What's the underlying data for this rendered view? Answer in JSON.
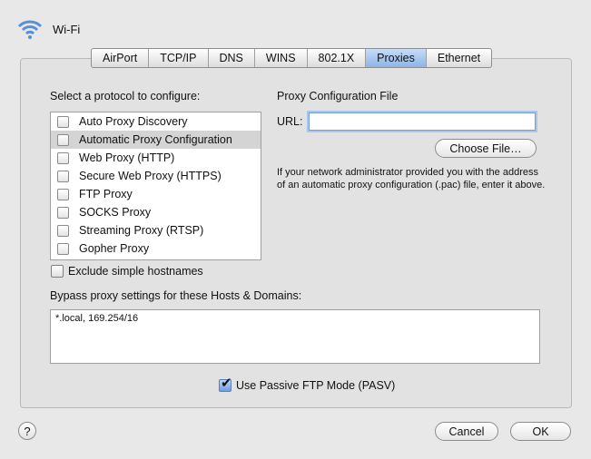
{
  "window": {
    "title": "Wi-Fi",
    "icon": "wifi-icon"
  },
  "tabs": [
    {
      "label": "AirPort",
      "active": false
    },
    {
      "label": "TCP/IP",
      "active": false
    },
    {
      "label": "DNS",
      "active": false
    },
    {
      "label": "WINS",
      "active": false
    },
    {
      "label": "802.1X",
      "active": false
    },
    {
      "label": "Proxies",
      "active": true
    },
    {
      "label": "Ethernet",
      "active": false
    }
  ],
  "protocols": {
    "heading": "Select a protocol to configure:",
    "items": [
      {
        "label": "Auto Proxy Discovery",
        "checked": false,
        "selected": false
      },
      {
        "label": "Automatic Proxy Configuration",
        "checked": false,
        "selected": true
      },
      {
        "label": "Web Proxy (HTTP)",
        "checked": false,
        "selected": false
      },
      {
        "label": "Secure Web Proxy (HTTPS)",
        "checked": false,
        "selected": false
      },
      {
        "label": "FTP Proxy",
        "checked": false,
        "selected": false
      },
      {
        "label": "SOCKS Proxy",
        "checked": false,
        "selected": false
      },
      {
        "label": "Streaming Proxy (RTSP)",
        "checked": false,
        "selected": false
      },
      {
        "label": "Gopher Proxy",
        "checked": false,
        "selected": false
      }
    ]
  },
  "config": {
    "heading": "Proxy Configuration File",
    "url_label": "URL:",
    "url_value": "",
    "choose_button": "Choose File…",
    "help_text": "If your network administrator provided you with the address of an automatic proxy configuration (.pac) file, enter it above."
  },
  "exclude_simple": {
    "label": "Exclude simple hostnames",
    "checked": false
  },
  "bypass": {
    "label": "Bypass proxy settings for these Hosts & Domains:",
    "value": "*.local, 169.254/16"
  },
  "passive_ftp": {
    "label": "Use Passive FTP Mode (PASV)",
    "checked": true
  },
  "footer": {
    "help": "?",
    "cancel": "Cancel",
    "ok": "OK"
  },
  "colors": {
    "accent": "#8db4e8",
    "focus_ring": "#a9c6ef"
  }
}
